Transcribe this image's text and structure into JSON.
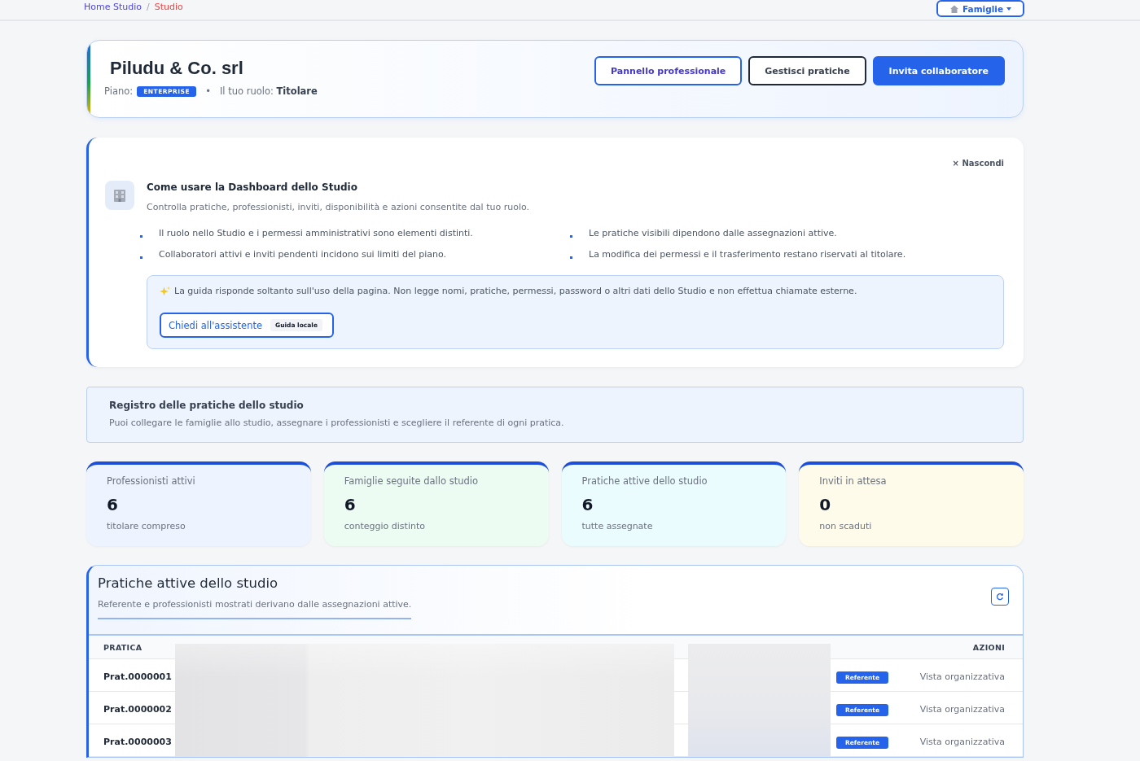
{
  "top_bar": {
    "breadcrumb": [
      {
        "label": "Home Studio",
        "current": false
      },
      {
        "label": "Studio",
        "current": true
      }
    ],
    "separator": "/",
    "menu_button": {
      "label": "Famiglie"
    }
  },
  "header": {
    "title": "Piludu & Co. srl",
    "plan_label": "Piano:",
    "plan_badge": "ENTERPRISE",
    "separator": "•",
    "role_text": "Il tuo ruolo: **Titolare**",
    "buttons": [
      {
        "label": "Pannello professionale",
        "kind": "outline-blue"
      },
      {
        "label": "Gestisci pratiche",
        "kind": "outline-dark"
      },
      {
        "label": "Invita collaboratore",
        "kind": "primary"
      }
    ]
  },
  "guide": {
    "hide_button": "× Nascondi",
    "title": "Come usare la Dashboard dello Studio",
    "subtitle": "Controlla pratiche, professionisti, inviti, disponibilità e azioni consentite dal tuo ruolo.",
    "tips": [
      "Il ruolo nello Studio e i permessi amministrativi sono elementi distinti.",
      "Le pratiche visibili dipendono dalle assegnazioni attive.",
      "Collaboratori attivi e inviti pendenti incidono sui limiti del piano.",
      "La modifica dei permessi e il trasferimento restano riservati al titolare."
    ],
    "assistant": {
      "note": "La guida risponde soltanto sull'uso della pagina. Non legge nomi, pratiche, permessi, password o altri dati dello Studio e non effettua chiamate esterne.",
      "button": "Chiedi all'assistente",
      "badge": "Guida locale"
    }
  },
  "registry": {
    "title": "Registro delle pratiche dello studio",
    "text": "Puoi collegare le famiglie allo studio, assegnare i professionisti e scegliere il referente di ogni pratica."
  },
  "stats": [
    {
      "label": "Professionisti attivi",
      "value": "6",
      "note": "titolare compreso",
      "color": "#eef4ff"
    },
    {
      "label": "Famiglie seguite dallo studio",
      "value": "6",
      "note": "conteggio distinto",
      "color": "#ecfcf2"
    },
    {
      "label": "Pratiche attive dello studio",
      "value": "6",
      "note": "tutte assegnate",
      "color": "#ebfcfe"
    },
    {
      "label": "Inviti in attesa",
      "value": "0",
      "note": "non scaduti",
      "color": "#fefbea"
    }
  ],
  "table": {
    "title": "Pratiche attive dello studio",
    "subtitle": "Referente e professionisti mostrati derivano dalle assegnazioni attive.",
    "columns": [
      "PRATICA",
      "AZIONI"
    ],
    "rows": [
      {
        "case": "Prat.0000001",
        "role_badge": "Referente",
        "action": "Vista organizzativa"
      },
      {
        "case": "Prat.0000002",
        "role_badge": "Referente",
        "action": "Vista organizzativa"
      },
      {
        "case": "Prat.0000003",
        "role_badge": "Referente",
        "action": "Vista organizzativa"
      }
    ]
  }
}
